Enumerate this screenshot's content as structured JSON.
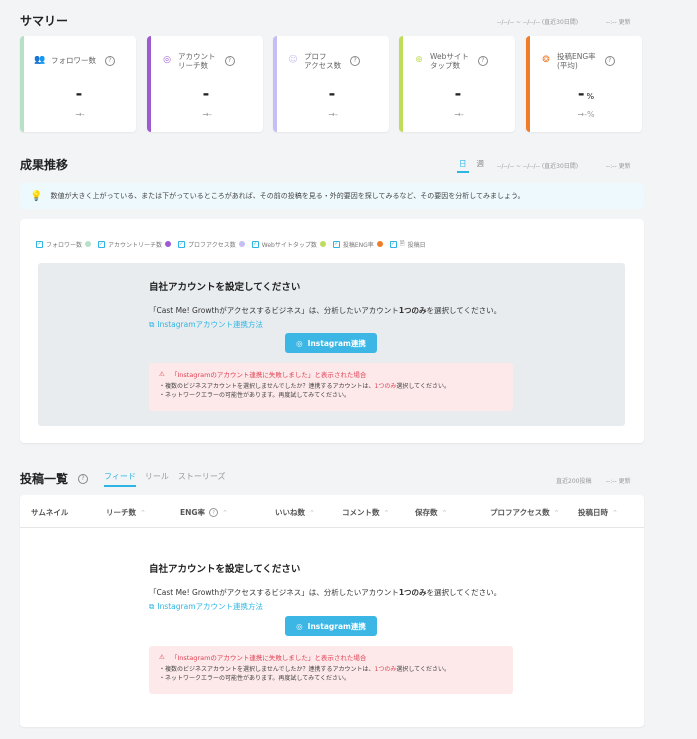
{
  "summary": {
    "title": "サマリー",
    "period": "--/--/-- ~ --/--/-- (直近30日間)",
    "updated": "--:-- 更新",
    "cards": [
      {
        "label": "フォロワー数",
        "value": "-",
        "unit": "",
        "diff": "→-",
        "color": "#b6e0c8",
        "icon": "followers-icon",
        "glyph": "👥"
      },
      {
        "label": "アカウント\nリーチ数",
        "value": "-",
        "unit": "",
        "diff": "→-",
        "color": "#9d5bd2",
        "icon": "reach-icon",
        "glyph": "◎"
      },
      {
        "label": "プロフ\nアクセス数",
        "value": "-",
        "unit": "",
        "diff": "→-",
        "color": "#c3bef3",
        "icon": "profile-icon",
        "glyph": "☺"
      },
      {
        "label": "Webサイト\nタップ数",
        "value": "-",
        "unit": "",
        "diff": "→-",
        "color": "#bfdc5a",
        "icon": "web-icon",
        "glyph": "⊕"
      },
      {
        "label": "投稿ENG率\n(平均)",
        "value": "-",
        "unit": "%",
        "diff": "→-%",
        "color": "#f07c2a",
        "icon": "eng-icon",
        "glyph": "❂"
      }
    ]
  },
  "trend": {
    "title": "成果推移",
    "tab_day": "日",
    "tab_week": "週",
    "period": "--/--/-- ~ --/--/-- (直近30日間)",
    "updated": "--:-- 更新",
    "tip": "数値が大きく上がっている、または下がっているところがあれば、その前の投稿を見る・外的要因を探してみるなど、その要因を分析してみましょう。",
    "legend": [
      {
        "label": "フォロワー数",
        "color": "#b6e0c8"
      },
      {
        "label": "アカウントリーチ数",
        "color": "#9d5bd2"
      },
      {
        "label": "プロフアクセス数",
        "color": "#c3bef3"
      },
      {
        "label": "Webサイトタップ数",
        "color": "#bfdc5a"
      },
      {
        "label": "投稿ENG率",
        "color": "#f07c2a"
      },
      {
        "label": "投稿日",
        "color": ""
      }
    ]
  },
  "setup": {
    "title": "自社アカウントを設定してください",
    "desc_pre": "「Cast Me! Growthがアクセスするビジネス」は、分析したいアカウント",
    "desc_bold": "1つのみ",
    "desc_post": "を選択してください。",
    "link": "Instagramアカウント連携方法",
    "button": "Instagram連携",
    "warn_title": "「Instagramのアカウント連携に失敗しました」と表示された場合",
    "warn_line1_pre": "・複数のビジネスアカウントを選択しませんでしたか？連携するアカウントは、",
    "warn_line1_red": "1つのみ",
    "warn_line1_post": "選択してください。",
    "warn_line2": "・ネットワークエラーの可能性があります。再度試してみてください。"
  },
  "posts": {
    "title": "投稿一覧",
    "tabs": [
      "フィード",
      "リール",
      "ストーリーズ"
    ],
    "period": "直近200投稿",
    "updated": "--:-- 更新",
    "columns": [
      "サムネイル",
      "リーチ数",
      "ENG率",
      "いいね数",
      "コメント数",
      "保存数",
      "プロフアクセス数",
      "投稿日時"
    ]
  },
  "colors": {
    "accent": "#2eb5e3",
    "error": "#e04355"
  }
}
